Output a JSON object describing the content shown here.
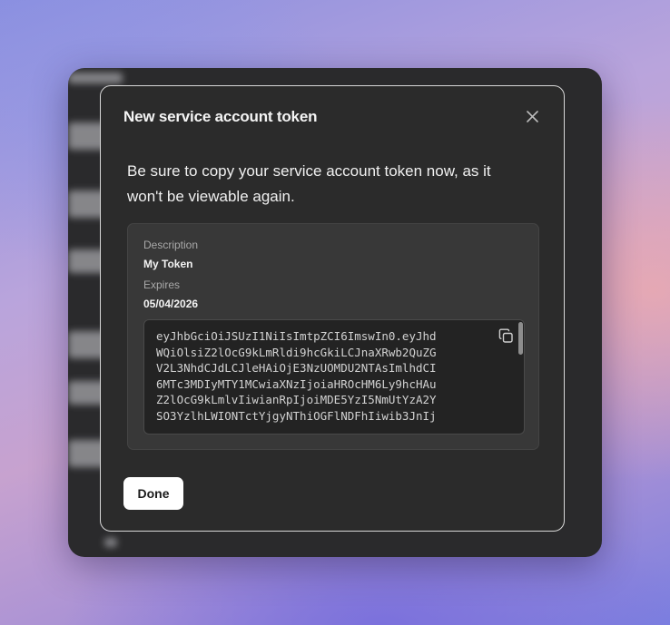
{
  "modal": {
    "title": "New service account token",
    "close_icon": "close-icon",
    "notice": "Be sure to copy your service account token now, as it won't be viewable again.",
    "description_label": "Description",
    "description_value": "My Token",
    "expires_label": "Expires",
    "expires_value": "05/04/2026",
    "token_lines": [
      "eyJhbGciOiJSUzI1NiIsImtpZCI6ImswIn0.eyJhd",
      "WQiOlsiZ2lOcG9kLmRldi9hcGkiLCJnaXRwb2QuZG",
      "V2L3NhdCJdLCJleHAiOjE3NzUOMDU2NTAsImlhdCI",
      "6MTc3MDIyMTY1MCwiaXNzIjoiaHROcHM6Ly9hcHAu",
      "Z2lOcG9kLmlvIiwianRpIjoiMDE5YzI5NmUtYzA2Y",
      "SO3YzlhLWIONTctYjgyNThiOGFlNDFhIiwib3JnIj"
    ],
    "copy_icon": "copy-icon",
    "done_label": "Done"
  },
  "colors": {
    "modal_bg": "#2b2b2b",
    "card_bg": "#383838",
    "token_bg": "#232323",
    "button_bg": "#ffffff"
  }
}
